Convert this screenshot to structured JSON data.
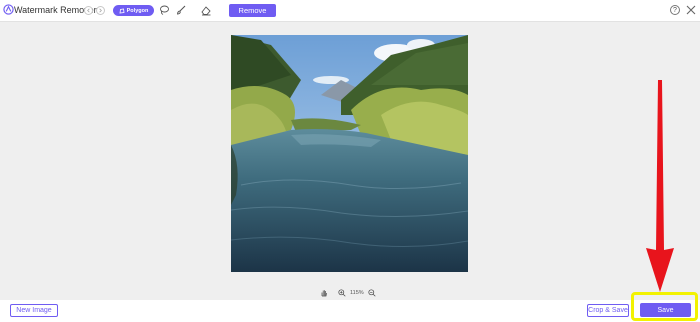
{
  "header": {
    "app_title": "Watermark Remover",
    "tools": {
      "polygon_label": "Polygon"
    },
    "remove_label": "Remove",
    "help_glyph": "?"
  },
  "canvas": {
    "image_alt": "Mountain lake with green trees",
    "zoom_level": "115%"
  },
  "footer": {
    "new_image_label": "New Image",
    "crop_save_label": "Crop & Save",
    "save_label": "Save"
  },
  "colors": {
    "accent": "#6f5cf2",
    "highlight": "#f2f200",
    "annotation_arrow": "#e8141c"
  },
  "icons": [
    "app-logo-icon",
    "undo-icon",
    "redo-icon",
    "polygon-icon",
    "lasso-icon",
    "brush-icon",
    "eraser-icon",
    "help-icon",
    "close-icon",
    "hand-icon",
    "zoom-in-icon",
    "zoom-out-icon"
  ]
}
